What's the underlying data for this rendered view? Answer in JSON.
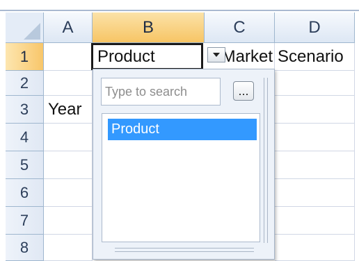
{
  "sheet": {
    "columns": [
      "A",
      "B",
      "C",
      "D"
    ],
    "rows": [
      "1",
      "2",
      "3",
      "4",
      "5",
      "6",
      "7",
      "8"
    ],
    "cells": {
      "B1": "Product",
      "C1": "Market",
      "D1": "Scenario",
      "A3": "Year"
    }
  },
  "dropdown": {
    "search_placeholder": "Type to search",
    "ellipsis_label": "...",
    "items": [
      "Product"
    ]
  },
  "colors": {
    "selected_header": "#f7c565",
    "header": "#dde7f4",
    "list_selection": "#3399ff"
  }
}
